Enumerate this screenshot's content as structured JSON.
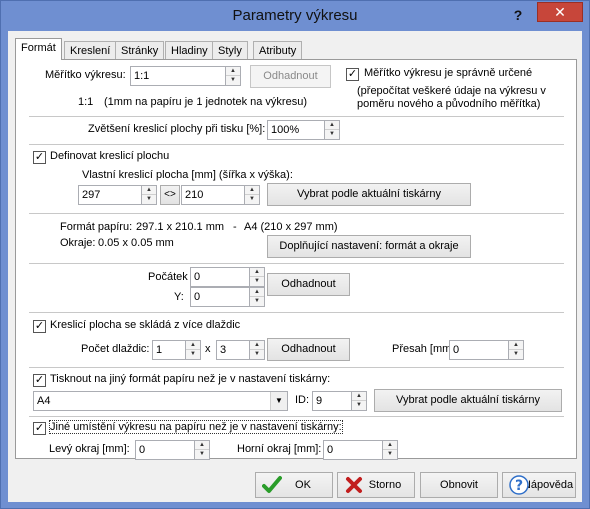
{
  "window": {
    "title": "Parametry výkresu",
    "help_label": "?",
    "close_label": "✕"
  },
  "tabs": [
    {
      "label": "Formát",
      "active": true
    },
    {
      "label": "Kreslení"
    },
    {
      "label": "Stránky"
    },
    {
      "label": "Hladiny"
    },
    {
      "label": "Styly"
    },
    {
      "label": "Atributy"
    }
  ],
  "scale": {
    "label": "Měřítko výkresu:",
    "value": "1:1",
    "estimate_button": "Odhadnout",
    "note_ratio": "1:1",
    "note_text": "(1mm na papíru je 1 jednotek na výkresu)",
    "correct_checkbox_label": "Měřítko výkresu je správně určené",
    "correct_checked": true,
    "correct_note_line1": "(přepočítat veškeré údaje na výkresu v",
    "correct_note_line2": "poměru nového a původního měřítka)"
  },
  "zoom": {
    "label": "Zvětšení kreslicí plochy při tisku [%]:",
    "value": "100%"
  },
  "drawing_area": {
    "checkbox_label": "Definovat kreslicí plochu",
    "checked": true,
    "own_label": "Vlastní kreslicí plocha [mm]  (šířka x výška):",
    "width": "297",
    "swap_label": "<>",
    "height": "210",
    "select_printer_button": "Vybrat podle aktuální tiskárny"
  },
  "paper": {
    "format_label": "Formát papíru:",
    "format_value": "297.1 x 210.1 mm",
    "format_dash": "-",
    "format_name": "A4 (210 x 297 mm)",
    "margins_label": "Okraje:",
    "margins_value": "0.05 x 0.05 mm",
    "extra_button": "Doplňující nastavení: formát a okraje"
  },
  "origin": {
    "start_label": "Počátek",
    "start_value": "0",
    "y_label": "Y:",
    "y_value": "0",
    "estimate_button": "Odhadnout"
  },
  "tiles": {
    "checkbox_label": "Kreslicí plocha se skládá z více dlaždic",
    "checked": true,
    "count_label": "Počet dlaždic:",
    "count_x": "1",
    "times": "x",
    "count_y": "3",
    "estimate_button": "Odhadnout",
    "overlap_label": "Přesah [mm]:",
    "overlap_value": "0"
  },
  "print_other": {
    "checkbox_label": "Tisknout na jiný formát papíru než je v nastavení tiskárny:",
    "checked": true,
    "format_value": "A4",
    "id_label": "ID:",
    "id_value": "9",
    "select_printer_button": "Vybrat podle aktuální tiskárny"
  },
  "placement": {
    "checkbox_label": "Jiné umístění výkresu na papíru než je v nastavení tiskárny:",
    "checked": true,
    "left_label": "Levý okraj [mm]:",
    "left_value": "0",
    "top_label": "Horní okraj [mm]:",
    "top_value": "0"
  },
  "buttons": {
    "ok": "OK",
    "cancel": "Storno",
    "refresh": "Obnovit",
    "help": "Nápověda"
  },
  "colors": {
    "title_bar": "#6f8fd1",
    "close_button": "#c7463a",
    "ok_check": "#2a9d2a",
    "cancel_x": "#c21e1e",
    "help_icon": "#2f6fc9"
  }
}
